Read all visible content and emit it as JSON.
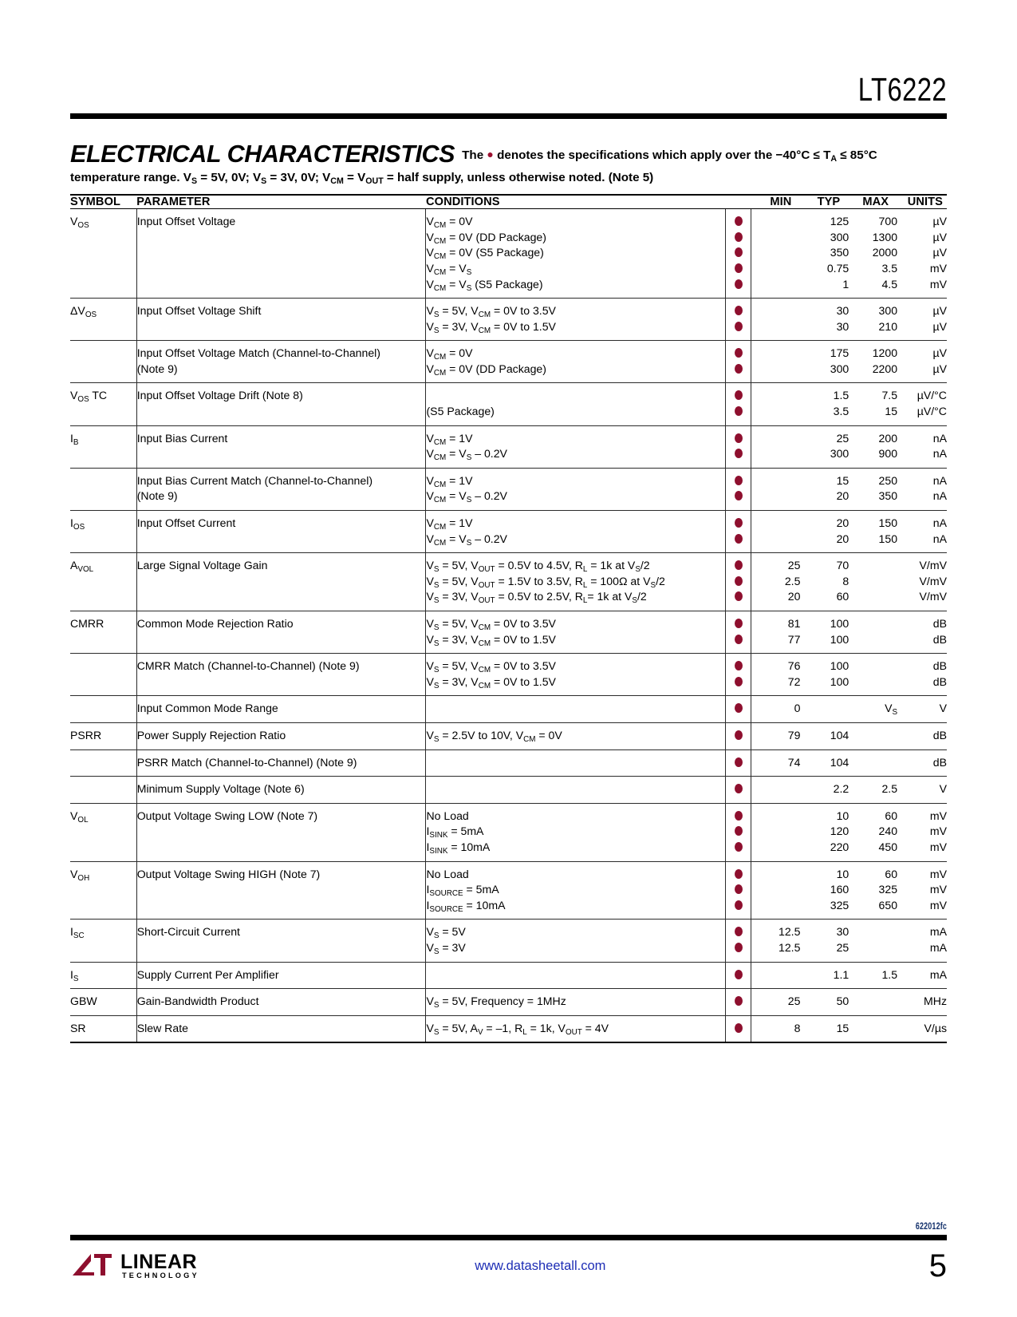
{
  "header": {
    "part_number": "LT6222"
  },
  "section": {
    "title": "ELECTRICAL CHARACTERISTICS",
    "note_prefix": "The",
    "note_after_bullet": "denotes the specifications which apply over the −40°C ≤ T",
    "note_sub_a": "A",
    "note_tail": " ≤ 85°C",
    "line2_part1": "temperature range. V",
    "line2_sub_s1": "S",
    "line2_part2": " = 5V, 0V; V",
    "line2_sub_s2": "S",
    "line2_part3": " = 3V, 0V; V",
    "line2_sub_cm": "CM",
    "line2_part4": " = V",
    "line2_sub_out": "OUT",
    "line2_part5": " = half supply, unless otherwise noted. (Note 5)"
  },
  "table": {
    "columns": [
      "SYMBOL",
      "PARAMETER",
      "CONDITIONS",
      "",
      "MIN",
      "TYP",
      "MAX",
      "UNITS"
    ],
    "rows": [
      {
        "symbol": "V_OS",
        "parameter": [
          "Input Offset Voltage"
        ],
        "conditions": [
          "V_CM = 0V",
          "V_CM = 0V (DD Package)",
          "V_CM = 0V (S5 Package)",
          "V_CM = V_S",
          "V_CM = V_S (S5 Package)"
        ],
        "min": [
          "",
          "",
          "",
          "",
          ""
        ],
        "typ": [
          "125",
          "300",
          "350",
          "0.75",
          "1"
        ],
        "max": [
          "700",
          "1300",
          "2000",
          "3.5",
          "4.5"
        ],
        "units": [
          "µV",
          "µV",
          "µV",
          "mV",
          "mV"
        ]
      },
      {
        "symbol": "ΔV_OS",
        "parameter": [
          "Input Offset Voltage Shift"
        ],
        "conditions": [
          "V_S = 5V, V_CM = 0V to 3.5V",
          "V_S = 3V, V_CM = 0V to 1.5V"
        ],
        "min": [
          "",
          ""
        ],
        "typ": [
          "30",
          "30"
        ],
        "max": [
          "300",
          "210"
        ],
        "units": [
          "µV",
          "µV"
        ]
      },
      {
        "symbol": "",
        "parameter": [
          "Input Offset Voltage Match (Channel-to-Channel)",
          "(Note 9)"
        ],
        "conditions": [
          "V_CM = 0V",
          "V_CM = 0V (DD Package)"
        ],
        "min": [
          "",
          ""
        ],
        "typ": [
          "175",
          "300"
        ],
        "max": [
          "1200",
          "2200"
        ],
        "units": [
          "µV",
          "µV"
        ]
      },
      {
        "symbol": "V_OS TC",
        "parameter": [
          "Input Offset Voltage Drift (Note 8)"
        ],
        "conditions": [
          "",
          "(S5 Package)"
        ],
        "min": [
          "",
          ""
        ],
        "typ": [
          "1.5",
          "3.5"
        ],
        "max": [
          "7.5",
          "15"
        ],
        "units": [
          "µV/°C",
          "µV/°C"
        ]
      },
      {
        "symbol": "I_B",
        "parameter": [
          "Input Bias Current"
        ],
        "conditions": [
          "V_CM = 1V",
          "V_CM = V_S – 0.2V"
        ],
        "min": [
          "",
          ""
        ],
        "typ": [
          "25",
          "300"
        ],
        "max": [
          "200",
          "900"
        ],
        "units": [
          "nA",
          "nA"
        ]
      },
      {
        "symbol": "",
        "parameter": [
          "Input Bias Current Match (Channel-to-Channel)",
          "(Note 9)"
        ],
        "conditions": [
          "V_CM = 1V",
          "V_CM = V_S – 0.2V"
        ],
        "min": [
          "",
          ""
        ],
        "typ": [
          "15",
          "20"
        ],
        "max": [
          "250",
          "350"
        ],
        "units": [
          "nA",
          "nA"
        ]
      },
      {
        "symbol": "I_OS",
        "parameter": [
          "Input Offset Current"
        ],
        "conditions": [
          "V_CM = 1V",
          "V_CM = V_S – 0.2V"
        ],
        "min": [
          "",
          ""
        ],
        "typ": [
          "20",
          "20"
        ],
        "max": [
          "150",
          "150"
        ],
        "units": [
          "nA",
          "nA"
        ]
      },
      {
        "symbol": "A_VOL",
        "parameter": [
          "Large Signal Voltage Gain"
        ],
        "conditions": [
          "V_S = 5V, V_OUT = 0.5V to 4.5V, R_L = 1k at V_S/2",
          "V_S = 5V, V_OUT = 1.5V to 3.5V, R_L = 100Ω at V_S/2",
          "V_S = 3V, V_OUT = 0.5V to 2.5V, R_L= 1k at V_S/2"
        ],
        "min": [
          "25",
          "2.5",
          "20"
        ],
        "typ": [
          "70",
          "8",
          "60"
        ],
        "max": [
          "",
          "",
          ""
        ],
        "units": [
          "V/mV",
          "V/mV",
          "V/mV"
        ]
      },
      {
        "symbol": "CMRR",
        "parameter": [
          "Common Mode Rejection Ratio"
        ],
        "conditions": [
          "V_S = 5V, V_CM = 0V to 3.5V",
          "V_S = 3V, V_CM = 0V to 1.5V"
        ],
        "min": [
          "81",
          "77"
        ],
        "typ": [
          "100",
          "100"
        ],
        "max": [
          "",
          ""
        ],
        "units": [
          "dB",
          "dB"
        ]
      },
      {
        "symbol": "",
        "parameter": [
          "CMRR Match (Channel-to-Channel) (Note 9)"
        ],
        "conditions": [
          "V_S = 5V, V_CM = 0V to 3.5V",
          "V_S = 3V, V_CM = 0V to 1.5V"
        ],
        "min": [
          "76",
          "72"
        ],
        "typ": [
          "100",
          "100"
        ],
        "max": [
          "",
          ""
        ],
        "units": [
          "dB",
          "dB"
        ]
      },
      {
        "symbol": "",
        "parameter": [
          "Input Common Mode Range"
        ],
        "conditions": [
          ""
        ],
        "min": [
          "0"
        ],
        "typ": [
          ""
        ],
        "max": [
          "V_S"
        ],
        "units": [
          "V"
        ]
      },
      {
        "symbol": "PSRR",
        "parameter": [
          "Power Supply Rejection Ratio"
        ],
        "conditions": [
          "V_S = 2.5V to 10V, V_CM = 0V"
        ],
        "min": [
          "79"
        ],
        "typ": [
          "104"
        ],
        "max": [
          ""
        ],
        "units": [
          "dB"
        ]
      },
      {
        "symbol": "",
        "parameter": [
          "PSRR Match (Channel-to-Channel) (Note 9)"
        ],
        "conditions": [
          ""
        ],
        "min": [
          "74"
        ],
        "typ": [
          "104"
        ],
        "max": [
          ""
        ],
        "units": [
          "dB"
        ]
      },
      {
        "symbol": "",
        "parameter": [
          "Minimum Supply Voltage (Note 6)"
        ],
        "conditions": [
          ""
        ],
        "min": [
          ""
        ],
        "typ": [
          "2.2"
        ],
        "max": [
          "2.5"
        ],
        "units": [
          "V"
        ]
      },
      {
        "symbol": "V_OL",
        "parameter": [
          "Output Voltage Swing LOW (Note 7)"
        ],
        "conditions": [
          "No Load",
          "I_SINK = 5mA",
          "I_SINK = 10mA"
        ],
        "min": [
          "",
          "",
          ""
        ],
        "typ": [
          "10",
          "120",
          "220"
        ],
        "max": [
          "60",
          "240",
          "450"
        ],
        "units": [
          "mV",
          "mV",
          "mV"
        ]
      },
      {
        "symbol": "V_OH",
        "parameter": [
          "Output Voltage Swing HIGH (Note 7)"
        ],
        "conditions": [
          "No Load",
          "I_SOURCE = 5mA",
          "I_SOURCE = 10mA"
        ],
        "min": [
          "",
          "",
          ""
        ],
        "typ": [
          "10",
          "160",
          "325"
        ],
        "max": [
          "60",
          "325",
          "650"
        ],
        "units": [
          "mV",
          "mV",
          "mV"
        ]
      },
      {
        "symbol": "I_SC",
        "parameter": [
          "Short-Circuit Current"
        ],
        "conditions": [
          "V_S = 5V",
          "V_S = 3V"
        ],
        "min": [
          "12.5",
          "12.5"
        ],
        "typ": [
          "30",
          "25"
        ],
        "max": [
          "",
          ""
        ],
        "units": [
          "mA",
          "mA"
        ]
      },
      {
        "symbol": "I_S",
        "parameter": [
          "Supply Current Per Amplifier"
        ],
        "conditions": [
          ""
        ],
        "min": [
          ""
        ],
        "typ": [
          "1.1"
        ],
        "max": [
          "1.5"
        ],
        "units": [
          "mA"
        ]
      },
      {
        "symbol": "GBW",
        "parameter": [
          "Gain-Bandwidth Product"
        ],
        "conditions": [
          "V_S = 5V, Frequency = 1MHz"
        ],
        "min": [
          "25"
        ],
        "typ": [
          "50"
        ],
        "max": [
          ""
        ],
        "units": [
          "MHz"
        ]
      },
      {
        "symbol": "SR",
        "parameter": [
          "Slew Rate"
        ],
        "conditions": [
          "V_S = 5V, A_V = –1, R_L = 1k, V_OUT = 4V"
        ],
        "min": [
          "8"
        ],
        "typ": [
          "15"
        ],
        "max": [
          ""
        ],
        "units": [
          "V/µs"
        ]
      }
    ]
  },
  "footer": {
    "doc_code": "622012fc",
    "logo_name": "LINEAR",
    "logo_sub": "TECHNOLOGY",
    "url": "www.datasheetall.com",
    "page_number": "5"
  },
  "colors": {
    "bullet": "#8E0F2E",
    "link": "#1D2DB5",
    "doc_code": "#13306B"
  }
}
